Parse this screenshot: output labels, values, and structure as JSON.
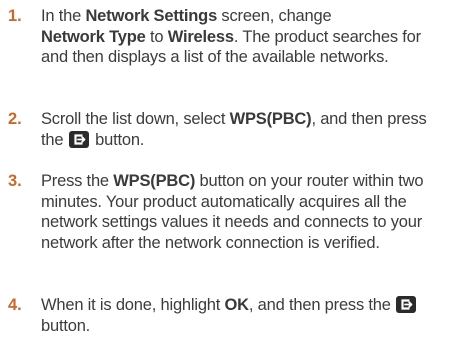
{
  "steps": [
    {
      "number": "1.",
      "p1": "In the ",
      "b1": "Network Settings",
      "p2": " screen, change ",
      "b2": "Network Type",
      "p3": " to ",
      "b3": "Wireless",
      "p4": ". The product searches for and then displays a list of the available networks."
    },
    {
      "number": "2.",
      "p1": "Scroll the list down, select ",
      "b1": "WPS(PBC)",
      "p2": ", and then press the ",
      "icon": "enter-button-icon",
      "p3": " button."
    },
    {
      "number": "3.",
      "p1": "Press the ",
      "b1": "WPS(PBC)",
      "p2": " button on your router within two minutes. Your product automatically acquires all the network settings values it needs and connects to your network after the network connection is verified."
    },
    {
      "number": "4.",
      "p1": "When it is done, highlight ",
      "b1": "OK",
      "p2": ", and then press the ",
      "icon": "enter-button-icon",
      "p3": " button."
    }
  ],
  "colors": {
    "number": "#c8692a",
    "text": "#3c3c3c",
    "icon_bg": "#2b2b2b",
    "icon_fg": "#ffffff"
  }
}
